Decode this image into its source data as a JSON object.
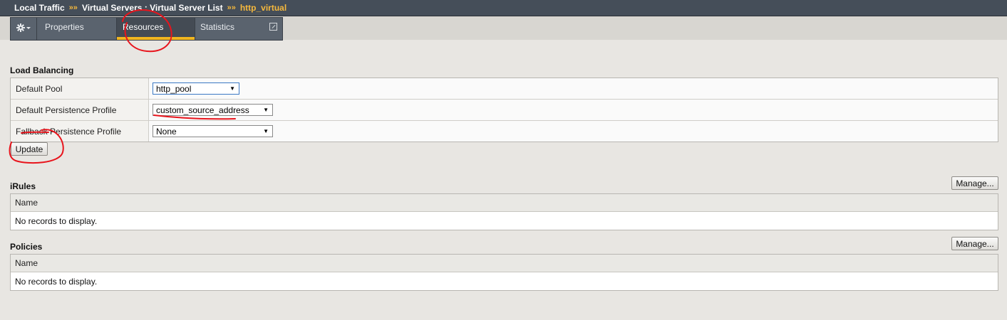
{
  "breadcrumb": {
    "items": [
      "Local Traffic",
      "Virtual Servers : Virtual Server List"
    ],
    "separator": "»»",
    "current": "http_virtual"
  },
  "tabs": {
    "gear_icon": "gear-icon",
    "properties": "Properties",
    "resources": "Resources",
    "statistics": "Statistics",
    "active": "Resources"
  },
  "load_balancing": {
    "title": "Load Balancing",
    "rows": [
      {
        "label": "Default Pool",
        "value": "http_pool"
      },
      {
        "label": "Default Persistence Profile",
        "value": "custom_source_address"
      },
      {
        "label": "Fallback Persistence Profile",
        "value": "None"
      }
    ],
    "update_label": "Update"
  },
  "irules": {
    "title": "iRules",
    "manage_label": "Manage...",
    "column": "Name",
    "empty_text": "No records to display."
  },
  "policies": {
    "title": "Policies",
    "manage_label": "Manage...",
    "column": "Name",
    "empty_text": "No records to display."
  },
  "colors": {
    "header_bg": "#454e59",
    "accent": "#f2b61f",
    "page_bg": "#e8e6e2",
    "annotation": "#e8141c"
  }
}
